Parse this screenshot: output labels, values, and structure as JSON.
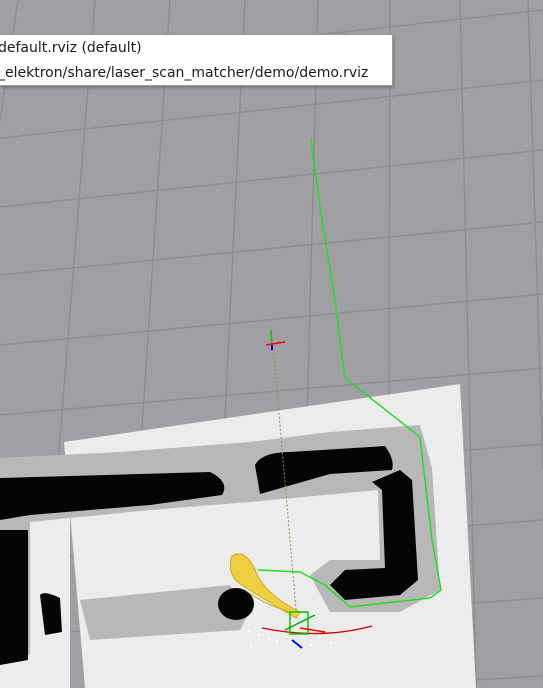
{
  "app": "RViz",
  "config_menu": {
    "items": [
      {
        "label": "default.rviz (default)"
      },
      {
        "label": "_elektron/share/laser_scan_matcher/demo/demo.rviz"
      }
    ]
  },
  "scene": {
    "background_color": "#a0a0a4",
    "grid_color": "#8c8c90",
    "map_free_color": "#ececec",
    "map_unknown_color": "#b5b5b5",
    "map_occupied_color": "#000000",
    "path_color": "#22dd22",
    "laser_color": "#f0d040",
    "axis_x_color": "#ff0000",
    "axis_y_color": "#00cc00",
    "axis_z_color": "#0000ff"
  }
}
